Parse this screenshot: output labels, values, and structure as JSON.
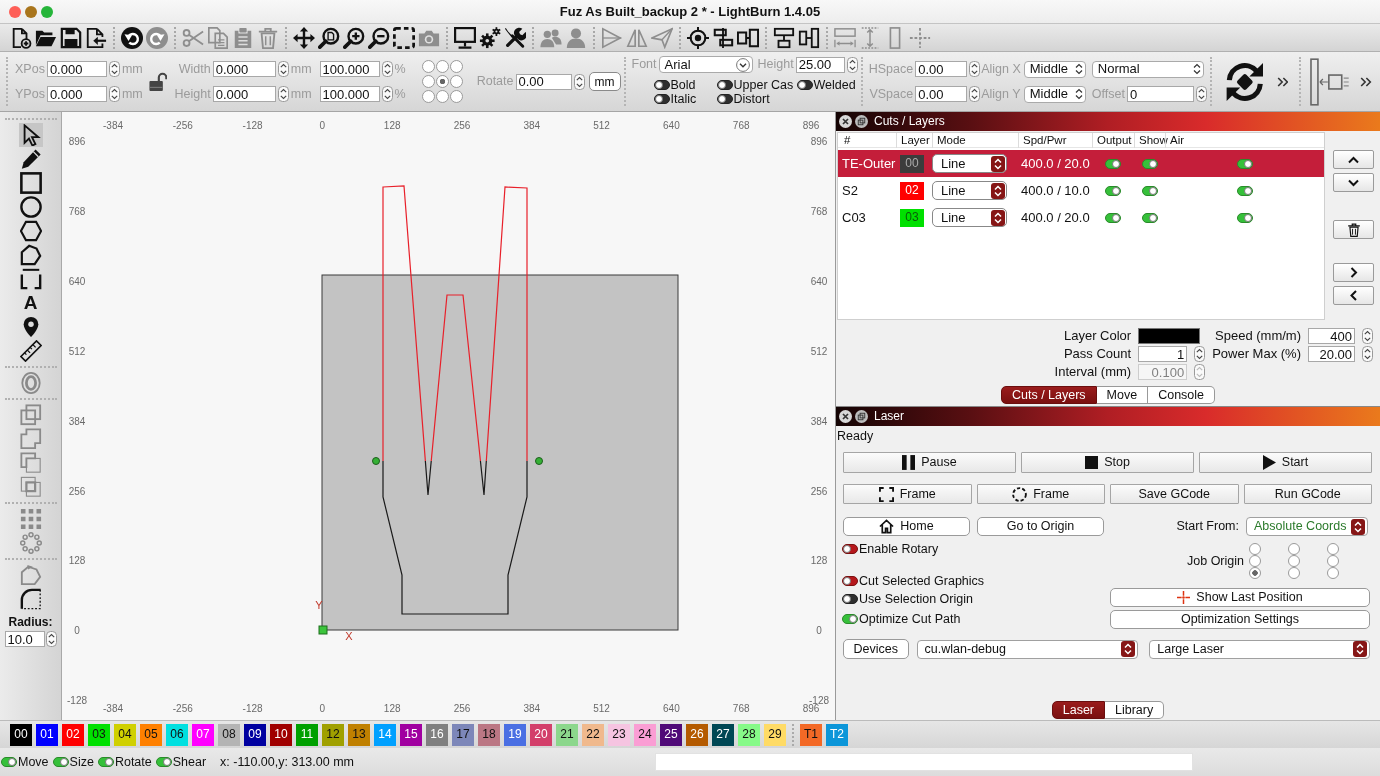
{
  "window": {
    "title": "Fuz As Built_backup 2 * - LightBurn 1.4.05"
  },
  "main_toolbar": {
    "buttons": [
      {
        "disabled": false
      },
      {
        "disabled": false
      },
      {
        "disabled": false
      },
      {
        "disabled": false
      },
      {
        "disabled": false
      },
      {
        "disabled": true
      },
      {
        "disabled": true
      },
      {
        "disabled": true
      },
      {
        "disabled": true
      },
      {
        "disabled": true
      },
      {
        "disabled": false
      },
      {
        "disabled": false
      },
      {
        "disabled": false
      },
      {
        "disabled": false
      },
      {
        "disabled": false
      },
      {
        "disabled": true
      },
      {
        "disabled": false
      },
      {
        "disabled": false
      },
      {
        "disabled": false
      },
      {
        "disabled": true
      },
      {
        "disabled": true
      },
      {
        "disabled": true
      },
      {
        "disabled": true
      },
      {
        "disabled": true
      },
      {
        "disabled": false
      },
      {
        "disabled": false
      },
      {
        "disabled": false
      },
      {
        "disabled": false
      },
      {
        "disabled": false
      },
      {
        "disabled": true
      },
      {
        "disabled": true
      },
      {
        "disabled": true
      },
      {
        "disabled": true
      }
    ]
  },
  "position_bar": {
    "xpos": {
      "label": "XPos",
      "value": "0.000",
      "unit": "mm"
    },
    "ypos": {
      "label": "YPos",
      "value": "0.000",
      "unit": "mm"
    },
    "width": {
      "label": "Width",
      "value": "0.000",
      "unit": "mm"
    },
    "height": {
      "label": "Height",
      "value": "0.000",
      "unit": "mm"
    },
    "scale_x": {
      "value": "100.000",
      "unit": "%"
    },
    "scale_y": {
      "value": "100.000",
      "unit": "%"
    },
    "anchor": [
      {
        "selected": false
      },
      {
        "selected": false
      },
      {
        "selected": false
      },
      {
        "selected": false
      },
      {
        "selected": true
      },
      {
        "selected": false
      },
      {
        "selected": false
      },
      {
        "selected": false
      },
      {
        "selected": false
      }
    ],
    "rotate": {
      "label": "Rotate",
      "value": "0.00"
    },
    "unit_button": "mm"
  },
  "text_bar": {
    "font": {
      "label": "Font",
      "value": "Arial"
    },
    "height": {
      "label": "Height",
      "value": "25.00"
    },
    "toggles": [
      {
        "label": "Bold",
        "on": false
      },
      {
        "label": "Italic",
        "on": false
      },
      {
        "label": "Upper Cas",
        "on": false
      },
      {
        "label": "Distort",
        "on": false
      },
      {
        "label": "Welded",
        "on": false
      }
    ],
    "hspace": {
      "label": "HSpace",
      "value": "0.00"
    },
    "vspace": {
      "label": "VSpace",
      "value": "0.00"
    },
    "align_x": {
      "label": "Align X",
      "value": "Middle"
    },
    "align_y": {
      "label": "Align Y",
      "value": "Middle"
    },
    "style": "Normal",
    "offset": {
      "label": "Offset",
      "value": "0"
    }
  },
  "left_tools": {
    "tools": [
      {
        "selected": true,
        "disabled": false
      },
      {
        "selected": false,
        "disabled": false
      },
      {
        "selected": false,
        "disabled": false
      },
      {
        "selected": false,
        "disabled": false
      },
      {
        "selected": false,
        "disabled": false
      },
      {
        "selected": false,
        "disabled": false
      },
      {
        "selected": false,
        "disabled": false
      },
      {
        "selected": false,
        "disabled": false,
        "glyph": "A"
      },
      {
        "selected": false,
        "disabled": false
      },
      {
        "selected": false,
        "disabled": false
      },
      {
        "selected": false,
        "disabled": true
      },
      {
        "selected": false,
        "disabled": true
      },
      {
        "selected": false,
        "disabled": true
      },
      {
        "selected": false,
        "disabled": true
      },
      {
        "selected": false,
        "disabled": true
      },
      {
        "selected": false,
        "disabled": true
      },
      {
        "selected": false,
        "disabled": true
      },
      {
        "selected": false,
        "disabled": true
      },
      {
        "selected": false,
        "disabled": false
      }
    ],
    "radius": {
      "label": "Radius:",
      "value": "10.0"
    }
  },
  "canvas": {
    "top_ruler": [
      "-384",
      "-256",
      "-128",
      "0",
      "128",
      "256",
      "384",
      "512",
      "640",
      "768",
      "896"
    ],
    "left_ruler": [
      "896",
      "768",
      "640",
      "512",
      "384",
      "256",
      "128",
      "0",
      "-128"
    ],
    "right_ruler": [
      "896",
      "768",
      "640",
      "512",
      "384",
      "256",
      "128",
      "0",
      "-128"
    ],
    "bottom_ruler": [
      "-384",
      "-256",
      "-128",
      "0",
      "128",
      "256",
      "384",
      "512",
      "640",
      "768",
      "896"
    ],
    "y_axis_label": "Y",
    "x_axis_label": "X"
  },
  "cuts_layers": {
    "title": "Cuts / Layers",
    "columns": [
      "#",
      "Layer",
      "Mode",
      "Spd/Pwr",
      "Output",
      "Show",
      "Air"
    ],
    "rows": [
      {
        "name": "TE-Outer",
        "layer": "00",
        "color": "#3c3c3c",
        "mode": "Line",
        "speed_power": "400.0 / 20.0",
        "output": true,
        "show": true,
        "air": true,
        "selected": true
      },
      {
        "name": "S2",
        "layer": "02",
        "color": "#ff0000",
        "mode": "Line",
        "speed_power": "400.0 / 10.0",
        "output": true,
        "show": true,
        "air": true,
        "selected": false
      },
      {
        "name": "C03",
        "layer": "03",
        "color": "#00e000",
        "mode": "Line",
        "speed_power": "400.0 / 20.0",
        "output": true,
        "show": true,
        "air": true,
        "selected": false
      }
    ],
    "settings": {
      "layer_color": {
        "label": "Layer Color",
        "color": "#000000"
      },
      "pass_count": {
        "label": "Pass Count",
        "value": "1"
      },
      "interval": {
        "label": "Interval (mm)",
        "value": "0.100",
        "disabled": true
      },
      "speed": {
        "label": "Speed (mm/m)",
        "value": "400"
      },
      "power_max": {
        "label": "Power Max (%)",
        "value": "20.00"
      }
    },
    "tabs": [
      {
        "label": "Cuts / Layers",
        "selected": true
      },
      {
        "label": "Move",
        "selected": false
      },
      {
        "label": "Console",
        "selected": false
      }
    ]
  },
  "laser": {
    "title": "Laser",
    "status": "Ready",
    "job_buttons": [
      "Pause",
      "Stop",
      "Start"
    ],
    "frame_buttons": [
      "Frame",
      "Frame",
      "Save GCode",
      "Run GCode"
    ],
    "home_button": "Home",
    "origin_button": "Go to Origin",
    "start_from": {
      "label": "Start From:",
      "value": "Absolute Coords"
    },
    "options": [
      {
        "label": "Enable Rotary",
        "on": false,
        "disabled": false
      },
      {
        "label": "Cut Selected Graphics",
        "on": false,
        "disabled": false
      },
      {
        "label": "Use Selection Origin",
        "on": false,
        "disabled": true
      },
      {
        "label": "Optimize Cut Path",
        "on": true,
        "disabled": false
      }
    ],
    "job_origin": {
      "label": "Job Origin",
      "points": [
        {
          "selected": false
        },
        {
          "selected": false
        },
        {
          "selected": false
        },
        {
          "selected": false
        },
        {
          "selected": false
        },
        {
          "selected": false
        },
        {
          "selected": true
        },
        {
          "selected": false
        },
        {
          "selected": false
        }
      ]
    },
    "show_last_position": "Show Last Position",
    "optimization_settings": "Optimization Settings",
    "devices_button": "Devices",
    "port": "cu.wlan-debug",
    "device": "Large Laser",
    "tabs": [
      {
        "label": "Laser",
        "selected": true
      },
      {
        "label": "Library",
        "selected": false
      }
    ]
  },
  "palette": [
    {
      "label": "00",
      "color": "#000000"
    },
    {
      "label": "01",
      "color": "#0000ff"
    },
    {
      "label": "02",
      "color": "#ff0000"
    },
    {
      "label": "03",
      "color": "#00e000"
    },
    {
      "label": "04",
      "color": "#d0d000"
    },
    {
      "label": "05",
      "color": "#ff8000"
    },
    {
      "label": "06",
      "color": "#00e0e0"
    },
    {
      "label": "07",
      "color": "#ff00ff"
    },
    {
      "label": "08",
      "color": "#b4b4b4"
    },
    {
      "label": "09",
      "color": "#0000a0"
    },
    {
      "label": "10",
      "color": "#a00000"
    },
    {
      "label": "11",
      "color": "#00a000"
    },
    {
      "label": "12",
      "color": "#a0a000"
    },
    {
      "label": "13",
      "color": "#c08000"
    },
    {
      "label": "14",
      "color": "#00a0ff"
    },
    {
      "label": "15",
      "color": "#a000a0"
    },
    {
      "label": "16",
      "color": "#808080"
    },
    {
      "label": "17",
      "color": "#7d87b9"
    },
    {
      "label": "18",
      "color": "#bb7784"
    },
    {
      "label": "19",
      "color": "#4a6fe3"
    },
    {
      "label": "20",
      "color": "#d33f6a"
    },
    {
      "label": "21",
      "color": "#8cd78c"
    },
    {
      "label": "22",
      "color": "#f0b98d"
    },
    {
      "label": "23",
      "color": "#f6c4e1"
    },
    {
      "label": "24",
      "color": "#fa9ed4"
    },
    {
      "label": "25",
      "color": "#500a78"
    },
    {
      "label": "26",
      "color": "#b45a00"
    },
    {
      "label": "27",
      "color": "#004754"
    },
    {
      "label": "28",
      "color": "#86fa88"
    },
    {
      "label": "29",
      "color": "#ffdb66"
    },
    {
      "label": "T1",
      "color": "#f36926"
    },
    {
      "label": "T2",
      "color": "#0c96d9"
    }
  ],
  "status_bar": {
    "toggles": [
      {
        "label": "Move",
        "on": true
      },
      {
        "label": "Size",
        "on": true
      },
      {
        "label": "Rotate",
        "on": true
      },
      {
        "label": "Shear",
        "on": true
      }
    ],
    "coordinates": "x: -110.00,y: 313.00 mm",
    "progress": {
      "level": 0
    }
  }
}
